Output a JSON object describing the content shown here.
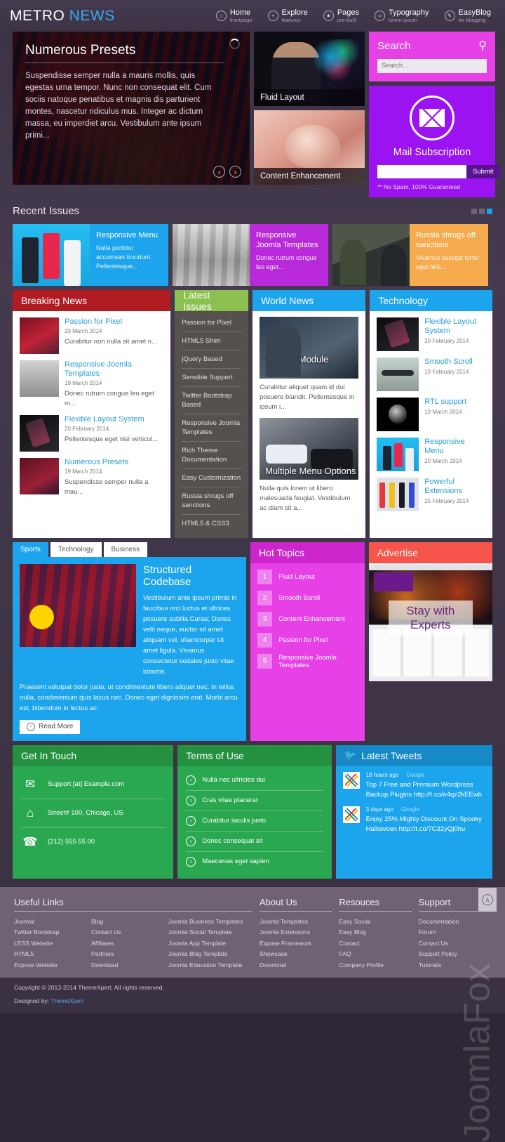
{
  "header": {
    "logo_part1": "METRO",
    "logo_part2": "NEWS",
    "nav": [
      {
        "label": "Home",
        "sub": "frontpage",
        "icon": "home-icon",
        "glyph": "⌂"
      },
      {
        "label": "Explore",
        "sub": "features",
        "icon": "plus-icon",
        "glyph": "+"
      },
      {
        "label": "Pages",
        "sub": "pre-built",
        "icon": "star-icon",
        "glyph": "★"
      },
      {
        "label": "Typography",
        "sub": "lorem ipsum",
        "icon": "code-icon",
        "glyph": "‹›"
      },
      {
        "label": "EasyBlog",
        "sub": "for blogging",
        "icon": "pencil-icon",
        "glyph": "✎"
      }
    ]
  },
  "slider": {
    "title": "Numerous Presets",
    "text": "Suspendisse semper nulla a mauris mollis, quis egestas urna tempor. Nunc non consequat elit. Cum sociis natoque penatibus et magnis dis parturient montes, nascetur ridiculus mus. Integer ac dictum massa, eu imperdiet arcu. Vestibulum ante ipsum primi...",
    "prev_glyph": "‹",
    "next_glyph": "›",
    "side_cards": [
      {
        "caption": "Fluid Layout",
        "art": "img-speaker"
      },
      {
        "caption": "Content Enhancement",
        "art": "img-baby"
      }
    ]
  },
  "search": {
    "title": "Search",
    "icon": "search-icon",
    "placeholder": "Search..."
  },
  "mail": {
    "title": "Mail Subscription",
    "icon": "envelope-icon",
    "input_value": "",
    "submit_label": "Submit",
    "note": "** No Spam, 100% Guaranteed"
  },
  "recent_issues": {
    "heading": "Recent Issues",
    "dots": [
      "off",
      "off",
      "on"
    ],
    "cards": [
      {
        "title": "Responsive Menu",
        "text": "Nulla porttitor accumsan tincidunt. Pellentesque...",
        "bg": "#1ca5ec",
        "art": "ph-phones"
      },
      {
        "title": "Responsive Joomla Templates",
        "text": "Donec rutrum congue leo eget...",
        "bg": "#b829d9",
        "art": "ph-corridor"
      },
      {
        "title": "Russia shrugs off sanctions",
        "text": "Vivamus suscipit tortor eget felis...",
        "bg": "#f5ab4e",
        "art": "ph-mil"
      }
    ]
  },
  "breaking_news": {
    "heading": "Breaking News",
    "head_color": "#b01c22",
    "items": [
      {
        "title": "Passion for Pixel",
        "date": "20 March 2014",
        "text": "Curabitur non nulla sit amet n...",
        "art": "a1"
      },
      {
        "title": "Responsive Joomla Templates",
        "date": "19 March 2014",
        "text": "Donec rutrum congue leo eget m...",
        "art": "a2"
      },
      {
        "title": "Flexible Layout System",
        "date": "20 February 2014",
        "text": "Pellentesque eget nisi vehicul...",
        "art": "a3"
      },
      {
        "title": "Numerous Presets",
        "date": "19 March 2014",
        "text": "Suspendisse semper nulla a mau...",
        "art": "a4"
      }
    ]
  },
  "latest_issues": {
    "heading": "Latest Issues",
    "head_color": "#8cc152",
    "items": [
      "Passion for Pixel",
      "HTML5 Shim",
      "jQuery Based",
      "Sensible Support",
      "Twitter Bootstrap Based",
      "Responsive Joomla Templates",
      "Rich Theme Documentation",
      "Easy Customization",
      "Russia shrugs off sanctions",
      "HTML5 & CSS3"
    ]
  },
  "world_news": {
    "heading": "World News",
    "head_color": "#1ca5ec",
    "items": [
      {
        "label": "Stylistic Module Classes",
        "text": "Curabitur aliquet quam id dui posuere blandit. Pellentesque in ipsum i...",
        "art": "w1"
      },
      {
        "label": "Multiple Menu Options",
        "text": "Nulla quis lorem ut libero malesuada feugiat. Vestibulum ac diam sit a...",
        "art": "w2"
      }
    ]
  },
  "technology": {
    "heading": "Technology",
    "head_color": "#1ca5ec",
    "items": [
      {
        "title": "Flexible Layout System",
        "date": "20 February 2014",
        "art": "a3"
      },
      {
        "title": "Smooth Scroll",
        "date": "19 February 2014",
        "art": "a5"
      },
      {
        "title": "RTL support",
        "date": "19 March 2014",
        "art": "a6"
      },
      {
        "title": "Responsive Menu",
        "date": "20 March 2014",
        "art": "a7"
      },
      {
        "title": "Powerful Extensions",
        "date": "25 February 2014",
        "art": "a8"
      }
    ]
  },
  "tabs_module": {
    "tabs": [
      "Sports",
      "Technology",
      "Business"
    ],
    "active_tab": "Sports",
    "title": "Structured Codebase",
    "paragraph1": "Vestibulum ante ipsum primis in faucibus orci luctus et ultrices posuere cubilia Curae; Donec velit neque, auctor sit amet aliquam vel, ullamcorper sit amet ligula. Vivamus consectetur sodales justo vitae lobortis.",
    "paragraph2": "Praesent volutpat dolor justo, ut condimentum libero aliquet nec. In tellus nulla, condimentum quis lacus nec. Donec eget dignissim erat. Morbi arcu est, bibendum in lectus ac.",
    "read_more": "Read More"
  },
  "hot_topics": {
    "heading": "Hot Topics",
    "items": [
      {
        "num": "1",
        "label": "Fluid Layout"
      },
      {
        "num": "2",
        "label": "Smooth Scroll"
      },
      {
        "num": "3",
        "label": "Content Enhancement"
      },
      {
        "num": "4",
        "label": "Passion for Pixel"
      },
      {
        "num": "5",
        "label": "Responsive Joomla Templates"
      }
    ]
  },
  "advertise": {
    "heading": "Advertise",
    "cta": "Stay with Experts"
  },
  "get_in_touch": {
    "heading": "Get In Touch",
    "items": [
      {
        "icon": "envelope-icon",
        "glyph": "✉",
        "text": "Support [at] Example.com"
      },
      {
        "icon": "home-icon",
        "glyph": "⌂",
        "text": "Street# 100, Chicago, US"
      },
      {
        "icon": "phone-icon",
        "glyph": "☎",
        "text": "(212) 555 55 00"
      }
    ]
  },
  "terms_of_use": {
    "heading": "Terms of Use",
    "items": [
      "Nulla nec ultricies dui",
      "Cras vitae placerat",
      "Curabitur iaculis justo",
      "Donec consequat sit",
      "Maecenas eget sapien"
    ]
  },
  "latest_tweets": {
    "heading": "Latest Tweets",
    "icon": "twitter-icon",
    "items": [
      {
        "time": "18 hours ago",
        "source": "Google",
        "body": "Top 7 Free and Premium Wordpress Backup Plugins http://t.co/e4qz2kEEwb"
      },
      {
        "time": "3 days ago",
        "source": "Google",
        "body": "Enjoy 25% Mighty Discount On Spooky Halloween http://t.co/7C32yQj0hu"
      }
    ]
  },
  "footer": {
    "useful": {
      "heading": "Useful Links",
      "col1": [
        "Joomla!",
        "Twitter Bootstrap",
        "LESS Website",
        "HTML5",
        "Expose Website"
      ],
      "col2": [
        "Blog",
        "Contact Us",
        "Affiliates",
        "Partners",
        "Download"
      ],
      "col3": [
        "Joomla Business Templates",
        "Joomla Social Template",
        "Joomla App Template",
        "Joomla Blog Template",
        "Joomla Education Template"
      ]
    },
    "about": {
      "heading": "About Us",
      "items": [
        "Joomla Templates",
        "Joomla Extensions",
        "Expose Framework",
        "Showcase",
        "Download"
      ]
    },
    "resources": {
      "heading": "Resouces",
      "items": [
        "Easy Social",
        "Easy Blog",
        "Contact",
        "FAQ",
        "Company Profile"
      ]
    },
    "support": {
      "heading": "Support",
      "items": [
        "Documentation",
        "Forum",
        "Contact Us",
        "Support Policy",
        "Tutorials"
      ]
    },
    "copyright": "Copyright © 2013-2014 ThemeXpert, All rights reserved.",
    "designed_prefix": "Designed by: ",
    "designed_by": "ThemeXpert",
    "to_top_glyph": "∧",
    "watermark": "JoomlaFox"
  }
}
